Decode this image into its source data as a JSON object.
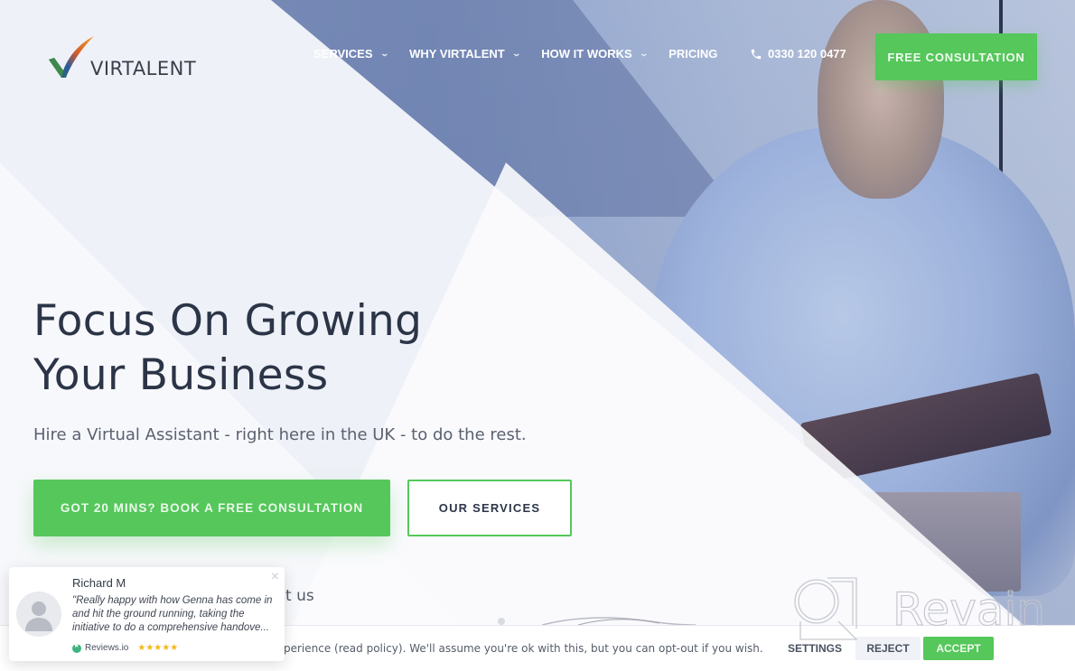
{
  "brand": {
    "name": "VIRTALENT",
    "accent_color": "#55c75b",
    "text_color": "#2c3547"
  },
  "header": {
    "nav": [
      {
        "label": "SERVICES",
        "has_dropdown": true,
        "icon": "chevron-down-icon"
      },
      {
        "label": "WHY VIRTALENT",
        "has_dropdown": true,
        "icon": "chevron-down-icon"
      },
      {
        "label": "HOW IT WORKS",
        "has_dropdown": true,
        "icon": "chevron-down-icon"
      },
      {
        "label": "PRICING",
        "has_dropdown": false
      }
    ],
    "phone": {
      "icon": "phone-icon",
      "number": "0330 120 0477"
    },
    "cta_label": "FREE CONSULTATION"
  },
  "hero": {
    "title_line1": "Focus On Growing",
    "title_line2": "Your Business",
    "subtitle": "Hire a Virtual Assistant - right here in the UK - to do the rest.",
    "primary_button": "GOT 20 MINS? BOOK A FREE CONSULTATION",
    "secondary_button": "OUR SERVICES",
    "partial_text": "t us"
  },
  "review_popup": {
    "name": "Richard M",
    "quote": "\"Really happy with how Genna has come in and hit the ground running, taking the initiative to do a comprehensive handove...",
    "source": "Reviews.io",
    "rating": 5,
    "stars": "★★★★★",
    "close_icon": "×"
  },
  "cookie_bar": {
    "text": "perience (read policy). We'll assume you're ok with this, but you can opt-out if you wish.",
    "settings_label": "SETTINGS",
    "reject_label": "REJECT",
    "accept_label": "ACCEPT"
  },
  "watermark": {
    "text": "Revain"
  }
}
